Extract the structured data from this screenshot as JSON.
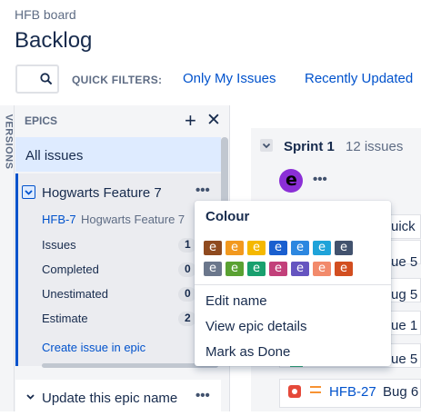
{
  "header": {
    "breadcrumb": "HFB board",
    "title": "Backlog"
  },
  "quick_filters": {
    "label": "QUICK FILTERS:",
    "only_my_issues": "Only My Issues",
    "recently_updated": "Recently Updated"
  },
  "versions": {
    "label": "VERSIONS"
  },
  "epics": {
    "label": "EPICS",
    "all_issues": "All issues",
    "selected": {
      "name": "Hogwarts Feature 7",
      "key": "HFB-7",
      "subtitle": "Hogwarts Feature 7",
      "stats": [
        {
          "label": "Issues",
          "value": "1"
        },
        {
          "label": "Completed",
          "value": "0"
        },
        {
          "label": "Unestimated",
          "value": "0"
        },
        {
          "label": "Estimate",
          "value": "2"
        }
      ],
      "create_link": "Create issue in epic"
    },
    "second": {
      "name": "Update this epic name"
    }
  },
  "sprint": {
    "name": "Sprint 1",
    "count": "12 issues",
    "avatar_letter": "e",
    "row_fragments": [
      "uick",
      "ue 5",
      "ug 5",
      "ue 1",
      "ue 5"
    ],
    "issue": {
      "key": "HFB-27",
      "title": "Bug 6"
    }
  },
  "colour_popup": {
    "heading": "Colour",
    "swatch_letter": "e",
    "row1": [
      "#8f4a1f",
      "#f2991f",
      "#f5b800",
      "#1a5fcf",
      "#2c87e0",
      "#1fa3d9",
      "#42526e"
    ],
    "row2": [
      "#6b778c",
      "#5aa132",
      "#19a06e",
      "#c2407a",
      "#6554c0",
      "#f28a6b",
      "#d24e20"
    ],
    "items": [
      "Edit name",
      "View epic details",
      "Mark as Done"
    ]
  },
  "icons": {
    "search": "search-icon",
    "plus": "plus-icon",
    "close": "close-icon"
  }
}
